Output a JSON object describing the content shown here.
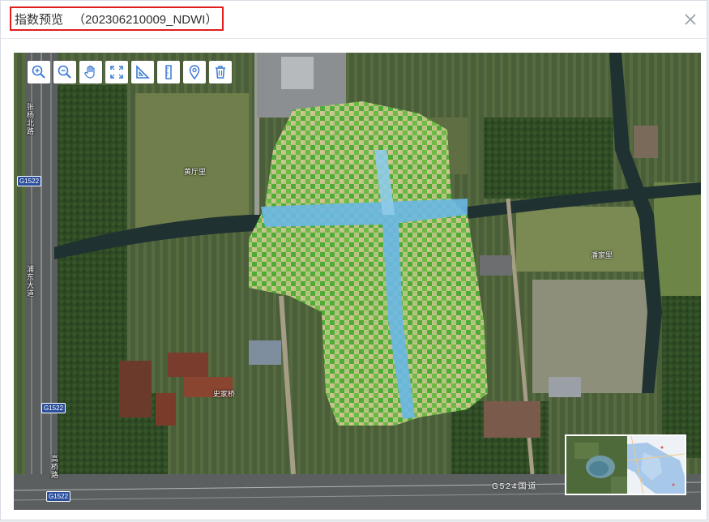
{
  "dialog": {
    "title": "指数预览",
    "image_id": "（202306210009_NDWI）",
    "close_icon": "close-icon"
  },
  "toolbar": {
    "tools": [
      {
        "name": "zoom-in",
        "icon": "zoom-in-icon"
      },
      {
        "name": "zoom-out",
        "icon": "zoom-out-icon"
      },
      {
        "name": "pan",
        "icon": "hand-icon"
      },
      {
        "name": "full-extent",
        "icon": "expand-icon"
      },
      {
        "name": "measure-area",
        "icon": "triangle-ruler-icon"
      },
      {
        "name": "measure-distance",
        "icon": "ruler-icon"
      },
      {
        "name": "locate",
        "icon": "location-pin-icon"
      },
      {
        "name": "clear",
        "icon": "trash-icon"
      }
    ]
  },
  "map": {
    "labels": {
      "road_left_top": "张杨北路",
      "road_left_mid": "浦东大道",
      "road_left_bottom": "高桥路",
      "village_north": "黄厅里",
      "village_east": "潘家里",
      "village_south": "史家桥",
      "highway_bottom": "G524国道"
    },
    "shields": [
      "G1522",
      "G1522",
      "G1522"
    ]
  },
  "colors": {
    "highlight_border": "#e11d1d",
    "tool_icon": "#3a7bd5",
    "ndwi_water": "#5fb4e8",
    "ndwi_veg": "#4caf3a",
    "ndwi_soil": "#d8c690"
  }
}
